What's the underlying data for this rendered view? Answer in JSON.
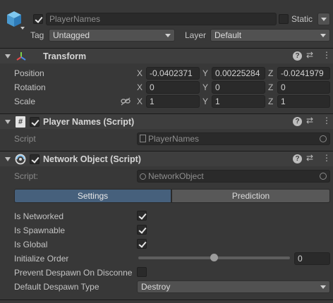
{
  "object": {
    "name": "PlayerNames",
    "static_label": "Static",
    "tag_label": "Tag",
    "tag_value": "Untagged",
    "layer_label": "Layer",
    "layer_value": "Default"
  },
  "transform": {
    "title": "Transform",
    "position": {
      "label": "Position",
      "x": "-0.0402371",
      "y": "0.00225284",
      "z": "-0.0241979"
    },
    "rotation": {
      "label": "Rotation",
      "x": "0",
      "y": "0",
      "z": "0"
    },
    "scale": {
      "label": "Scale",
      "x": "1",
      "y": "1",
      "z": "1"
    },
    "axis_x": "X",
    "axis_y": "Y",
    "axis_z": "Z"
  },
  "player_names": {
    "title": "Player Names (Script)",
    "script_label": "Script",
    "script_value": "PlayerNames"
  },
  "network_object": {
    "title": "Network Object (Script)",
    "script_label": "Script:",
    "script_value": "NetworkObject",
    "tabs": [
      "Settings",
      "Prediction"
    ],
    "is_networked_label": "Is Networked",
    "is_spawnable_label": "Is Spawnable",
    "is_global_label": "Is Global",
    "initialize_order_label": "Initialize Order",
    "initialize_order_value": "0",
    "initialize_order_slider": 0.5,
    "prevent_despawn_label": "Prevent Despawn On Disconne",
    "default_despawn_label": "Default Despawn Type",
    "default_despawn_value": "Destroy"
  },
  "colors": {
    "background": "#383838",
    "header": "#3e3e3e",
    "tab_selected": "#46607c",
    "field": "#2a2a2a"
  }
}
